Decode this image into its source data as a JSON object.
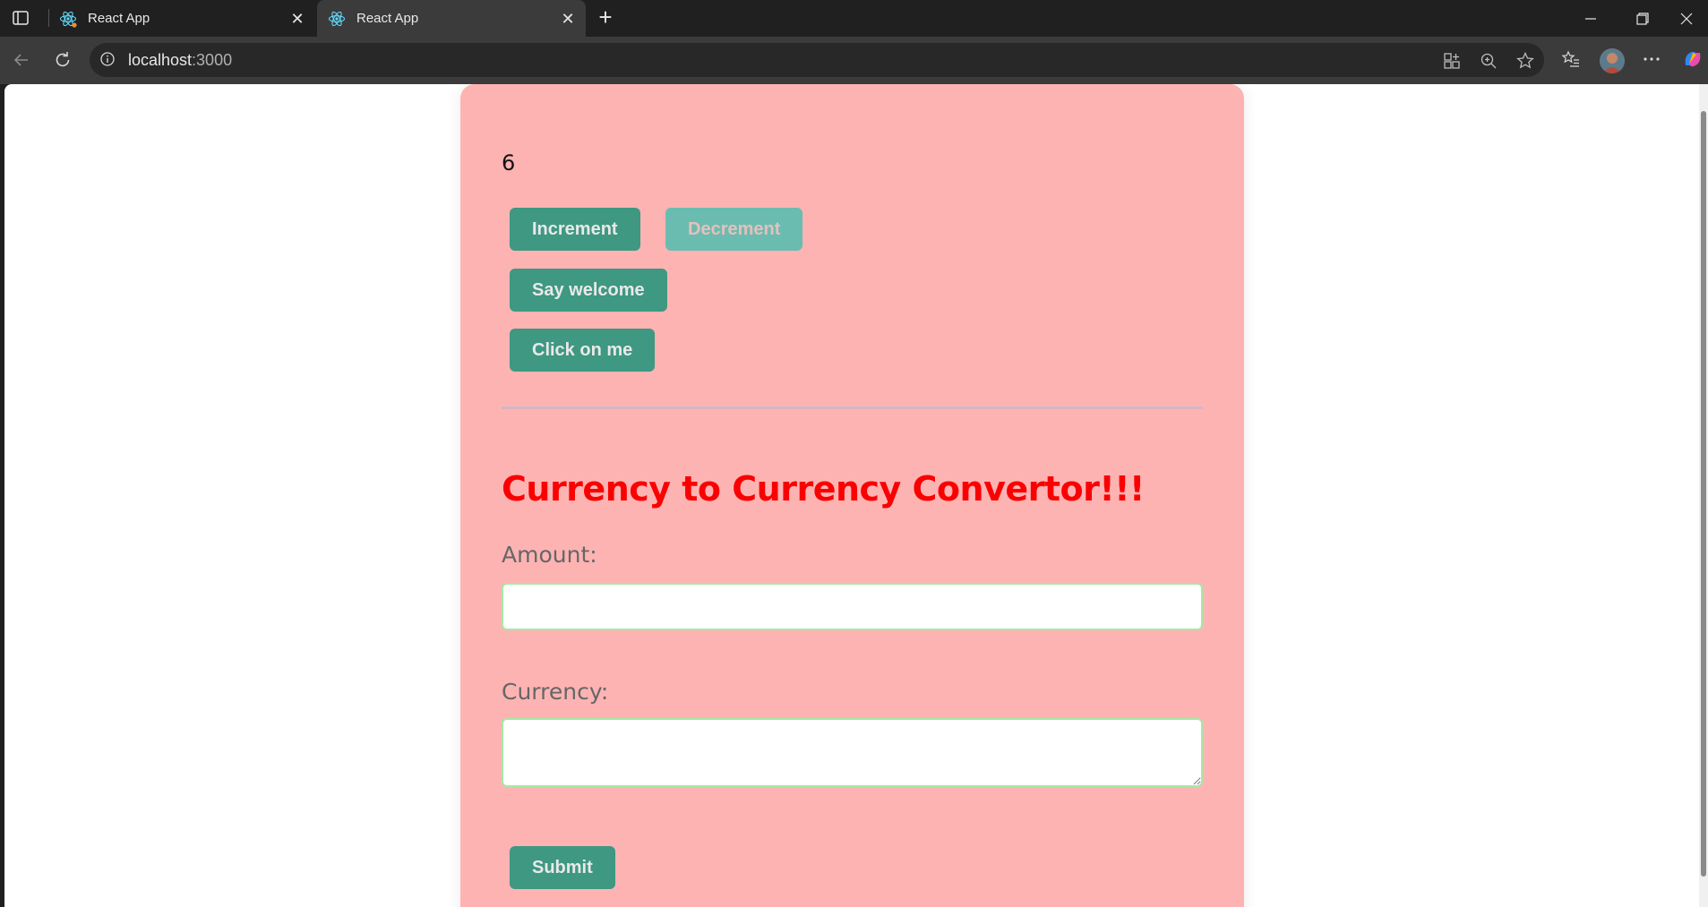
{
  "browser": {
    "tabs": [
      {
        "title": "React App"
      },
      {
        "title": "React App"
      }
    ],
    "url_host": "localhost",
    "url_port": ":3000"
  },
  "counter": {
    "value": "6",
    "increment_label": "Increment",
    "decrement_label": "Decrement",
    "welcome_label": "Say welcome",
    "click_label": "Click on me"
  },
  "converter": {
    "title": "Currency to Currency Convertor!!!",
    "amount_label": "Amount:",
    "amount_value": "",
    "currency_label": "Currency:",
    "currency_value": "",
    "submit_label": "Submit"
  },
  "colors": {
    "card_bg": "#feb3b3",
    "button_bg": "#3e9882",
    "title_color": "#fb0000"
  }
}
